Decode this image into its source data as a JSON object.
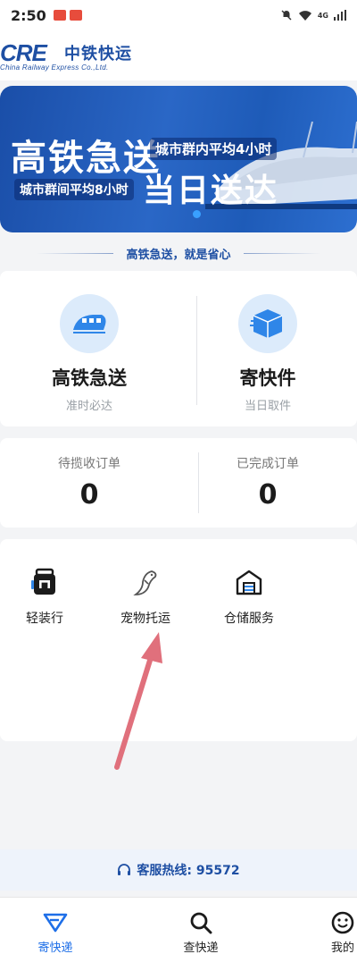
{
  "status_bar": {
    "time": "2:50",
    "network": "4G"
  },
  "header": {
    "logo_mark": "CRE",
    "logo_cn": "中铁快运",
    "logo_en": "China Railway Express Co.,Ltd."
  },
  "banner": {
    "title1": "高铁急送",
    "sub1": "城市群内平均4小时",
    "sub2": "城市群间平均8小时",
    "title2": "当日送达"
  },
  "slogan": "高铁急送，就是省心",
  "services": [
    {
      "title": "高铁急送",
      "subtitle": "准时必达",
      "icon": "train-icon"
    },
    {
      "title": "寄快件",
      "subtitle": "当日取件",
      "icon": "package-icon"
    }
  ],
  "orders": [
    {
      "label": "待揽收订单",
      "count": "0"
    },
    {
      "label": "已完成订单",
      "count": "0"
    }
  ],
  "tools": [
    {
      "label": "轻装行",
      "icon": "backpack-icon"
    },
    {
      "label": "宠物托运",
      "icon": "bird-icon"
    },
    {
      "label": "仓储服务",
      "icon": "warehouse-icon"
    }
  ],
  "hotline": "客服热线: 95572",
  "nav": [
    {
      "label": "寄快递",
      "icon": "send-icon",
      "active": true
    },
    {
      "label": "查快递",
      "icon": "search-icon",
      "active": false
    },
    {
      "label": "我的",
      "icon": "smile-icon",
      "active": false
    }
  ],
  "colors": {
    "brand": "#1e4fa3",
    "active_nav": "#1e6fe8",
    "annotation": "#e0707c"
  }
}
